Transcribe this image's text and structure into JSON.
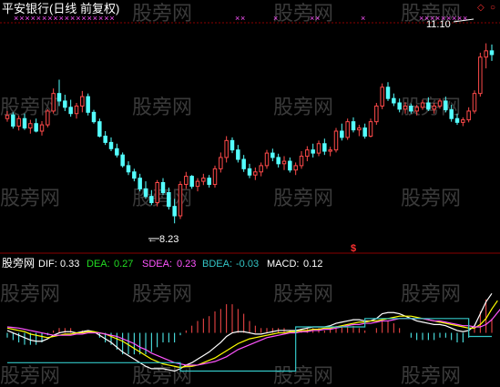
{
  "header": {
    "title": "平安银行(日线 前复权)"
  },
  "watermark": "股旁网",
  "indicator_bar": {
    "source": "股旁网",
    "dif_label": "DIF:",
    "dif_value": "0.33",
    "dea_label": "DEA:",
    "dea_value": "0.27",
    "sdea_label": "SDEA:",
    "sdea_value": "0.23",
    "bdea_label": "BDEA:",
    "bdea_value": "-0.03",
    "macd_label": "MACD:",
    "macd_value": "0.12"
  },
  "annotations": {
    "high_label": "11.10",
    "low_label": "8.23",
    "signal_marker": "$"
  },
  "colors": {
    "up": "#ff4a4a",
    "down": "#54ffff",
    "dif": "#ffffff",
    "dea": "#ffff00",
    "sdea": "#ff55ff",
    "bdea": "#33c6c6",
    "grid": "#8a0000",
    "accent_green": "#22dd22"
  },
  "chart_data": [
    {
      "type": "candlestick",
      "title": "平安银行(日线 前复权)",
      "ylim": [
        7.9,
        11.5
      ],
      "annotated_high": 11.1,
      "annotated_low": 8.23,
      "ohlc": [
        [
          9.9,
          10.02,
          9.85,
          9.95
        ],
        [
          9.96,
          10.0,
          9.74,
          9.78
        ],
        [
          9.78,
          9.95,
          9.71,
          9.9
        ],
        [
          9.9,
          9.98,
          9.72,
          9.75
        ],
        [
          9.75,
          9.88,
          9.66,
          9.82
        ],
        [
          9.82,
          9.9,
          9.68,
          9.7
        ],
        [
          9.7,
          9.86,
          9.63,
          9.8
        ],
        [
          9.8,
          10.05,
          9.76,
          10.02
        ],
        [
          10.02,
          10.38,
          9.98,
          10.3
        ],
        [
          10.3,
          10.52,
          10.1,
          10.18
        ],
        [
          10.18,
          10.28,
          10.02,
          10.08
        ],
        [
          10.08,
          10.2,
          9.93,
          9.98
        ],
        [
          9.98,
          10.15,
          9.9,
          10.1
        ],
        [
          10.1,
          10.34,
          10.0,
          10.25
        ],
        [
          10.25,
          10.3,
          9.95,
          10.0
        ],
        [
          10.0,
          10.04,
          9.82,
          9.85
        ],
        [
          9.85,
          9.9,
          9.6,
          9.62
        ],
        [
          9.62,
          9.7,
          9.48,
          9.52
        ],
        [
          9.52,
          9.6,
          9.38,
          9.42
        ],
        [
          9.42,
          9.5,
          9.28,
          9.32
        ],
        [
          9.32,
          9.36,
          9.12,
          9.15
        ],
        [
          9.15,
          9.22,
          9.0,
          9.05
        ],
        [
          9.05,
          9.1,
          8.9,
          8.95
        ],
        [
          8.95,
          9.02,
          8.74,
          8.78
        ],
        [
          8.78,
          8.9,
          8.62,
          8.66
        ],
        [
          8.66,
          8.76,
          8.52,
          8.56
        ],
        [
          8.56,
          8.92,
          8.5,
          8.88
        ],
        [
          8.88,
          8.95,
          8.68,
          8.72
        ],
        [
          8.72,
          8.8,
          8.45,
          8.5
        ],
        [
          8.5,
          8.62,
          8.23,
          8.35
        ],
        [
          8.35,
          8.9,
          8.3,
          8.85
        ],
        [
          8.85,
          9.05,
          8.78,
          8.98
        ],
        [
          8.98,
          9.0,
          8.78,
          8.82
        ],
        [
          8.82,
          8.95,
          8.74,
          8.9
        ],
        [
          8.9,
          9.02,
          8.84,
          8.95
        ],
        [
          8.95,
          9.0,
          8.8,
          8.85
        ],
        [
          8.85,
          9.15,
          8.8,
          9.1
        ],
        [
          9.1,
          9.36,
          9.04,
          9.28
        ],
        [
          9.28,
          9.62,
          9.2,
          9.55
        ],
        [
          9.55,
          9.6,
          9.35,
          9.4
        ],
        [
          9.4,
          9.48,
          9.2,
          9.25
        ],
        [
          9.25,
          9.32,
          9.05,
          9.1
        ],
        [
          9.1,
          9.18,
          8.95,
          9.0
        ],
        [
          9.0,
          9.12,
          8.92,
          9.05
        ],
        [
          9.05,
          9.2,
          8.98,
          9.15
        ],
        [
          9.15,
          9.4,
          9.1,
          9.35
        ],
        [
          9.35,
          9.42,
          9.22,
          9.28
        ],
        [
          9.28,
          9.34,
          9.12,
          9.18
        ],
        [
          9.18,
          9.3,
          9.08,
          9.22
        ],
        [
          9.22,
          9.28,
          9.04,
          9.08
        ],
        [
          9.08,
          9.2,
          9.0,
          9.15
        ],
        [
          9.15,
          9.38,
          9.1,
          9.3
        ],
        [
          9.3,
          9.46,
          9.22,
          9.4
        ],
        [
          9.4,
          9.5,
          9.28,
          9.35
        ],
        [
          9.35,
          9.55,
          9.3,
          9.5
        ],
        [
          9.5,
          9.58,
          9.32,
          9.38
        ],
        [
          9.38,
          9.45,
          9.3,
          9.4
        ],
        [
          9.4,
          9.75,
          9.36,
          9.7
        ],
        [
          9.7,
          9.82,
          9.55,
          9.6
        ],
        [
          9.6,
          9.9,
          9.56,
          9.85
        ],
        [
          9.85,
          9.92,
          9.68,
          9.72
        ],
        [
          9.72,
          9.8,
          9.62,
          9.75
        ],
        [
          9.75,
          9.82,
          9.58,
          9.62
        ],
        [
          9.62,
          9.9,
          9.6,
          9.85
        ],
        [
          9.85,
          10.15,
          9.8,
          10.1
        ],
        [
          10.1,
          10.46,
          10.05,
          10.4
        ],
        [
          10.4,
          10.48,
          10.18,
          10.22
        ],
        [
          10.22,
          10.3,
          10.1,
          10.15
        ],
        [
          10.15,
          10.22,
          10.0,
          10.05
        ],
        [
          10.05,
          10.16,
          9.98,
          10.1
        ],
        [
          10.1,
          10.14,
          9.98,
          10.02
        ],
        [
          10.02,
          10.12,
          9.95,
          10.08
        ],
        [
          10.08,
          10.2,
          10.04,
          10.15
        ],
        [
          10.15,
          10.24,
          10.02,
          10.05
        ],
        [
          10.05,
          10.15,
          9.98,
          10.1
        ],
        [
          10.1,
          10.22,
          10.06,
          10.18
        ],
        [
          10.18,
          10.25,
          10.0,
          10.04
        ],
        [
          10.04,
          10.12,
          9.85,
          9.9
        ],
        [
          9.9,
          9.98,
          9.8,
          9.84
        ],
        [
          9.84,
          9.92,
          9.78,
          9.88
        ],
        [
          9.88,
          10.08,
          9.84,
          10.02
        ],
        [
          10.02,
          10.35,
          9.98,
          10.3
        ],
        [
          10.3,
          10.95,
          10.25,
          10.88
        ],
        [
          10.88,
          11.1,
          10.7,
          10.98
        ],
        [
          10.98,
          11.08,
          10.82,
          10.92
        ]
      ]
    },
    {
      "type": "line",
      "title": "",
      "ylim": [
        -0.4,
        0.5
      ],
      "series": [
        {
          "name": "DIF",
          "values": [
            0.02,
            0.0,
            -0.02,
            -0.04,
            -0.06,
            -0.07,
            -0.07,
            -0.05,
            -0.02,
            0.0,
            0.01,
            0.01,
            0.0,
            0.01,
            0.02,
            0.01,
            -0.02,
            -0.05,
            -0.08,
            -0.12,
            -0.16,
            -0.19,
            -0.22,
            -0.25,
            -0.28,
            -0.3,
            -0.3,
            -0.3,
            -0.31,
            -0.32,
            -0.3,
            -0.27,
            -0.25,
            -0.22,
            -0.19,
            -0.16,
            -0.12,
            -0.08,
            -0.03,
            0.0,
            0.01,
            0.01,
            0.0,
            -0.01,
            -0.01,
            0.0,
            0.01,
            0.02,
            0.02,
            0.02,
            0.02,
            0.03,
            0.04,
            0.05,
            0.05,
            0.05,
            0.06,
            0.08,
            0.09,
            0.1,
            0.11,
            0.11,
            0.1,
            0.1,
            0.12,
            0.16,
            0.17,
            0.17,
            0.16,
            0.14,
            0.12,
            0.1,
            0.09,
            0.08,
            0.07,
            0.07,
            0.06,
            0.04,
            0.02,
            0.01,
            0.02,
            0.06,
            0.16,
            0.26,
            0.33
          ]
        },
        {
          "name": "DEA",
          "values": [
            0.04,
            0.03,
            0.02,
            0.01,
            -0.01,
            -0.02,
            -0.03,
            -0.04,
            -0.03,
            -0.02,
            -0.01,
            -0.01,
            0.0,
            0.0,
            0.01,
            0.01,
            0.0,
            -0.01,
            -0.03,
            -0.05,
            -0.07,
            -0.1,
            -0.13,
            -0.16,
            -0.19,
            -0.22,
            -0.24,
            -0.26,
            -0.27,
            -0.28,
            -0.29,
            -0.28,
            -0.28,
            -0.27,
            -0.25,
            -0.23,
            -0.21,
            -0.18,
            -0.15,
            -0.12,
            -0.09,
            -0.07,
            -0.05,
            -0.04,
            -0.03,
            -0.02,
            -0.01,
            0.0,
            0.0,
            0.01,
            0.01,
            0.02,
            0.02,
            0.03,
            0.03,
            0.04,
            0.04,
            0.05,
            0.06,
            0.07,
            0.08,
            0.09,
            0.09,
            0.1,
            0.1,
            0.11,
            0.12,
            0.13,
            0.14,
            0.14,
            0.14,
            0.13,
            0.12,
            0.11,
            0.1,
            0.09,
            0.08,
            0.07,
            0.06,
            0.05,
            0.04,
            0.04,
            0.07,
            0.12,
            0.2,
            0.27
          ]
        },
        {
          "name": "SDEA",
          "values": [
            0.05,
            0.045,
            0.04,
            0.03,
            0.02,
            0.01,
            0.0,
            -0.01,
            -0.02,
            -0.02,
            -0.02,
            -0.02,
            -0.01,
            -0.01,
            0.0,
            0.0,
            0.0,
            -0.01,
            -0.02,
            -0.03,
            -0.05,
            -0.07,
            -0.09,
            -0.12,
            -0.14,
            -0.17,
            -0.19,
            -0.21,
            -0.23,
            -0.25,
            -0.26,
            -0.27,
            -0.27,
            -0.27,
            -0.26,
            -0.25,
            -0.24,
            -0.22,
            -0.2,
            -0.17,
            -0.14,
            -0.12,
            -0.1,
            -0.08,
            -0.06,
            -0.04,
            -0.03,
            -0.02,
            -0.01,
            0.0,
            0.0,
            0.01,
            0.01,
            0.02,
            0.02,
            0.03,
            0.03,
            0.04,
            0.05,
            0.06,
            0.07,
            0.07,
            0.08,
            0.08,
            0.09,
            0.1,
            0.1,
            0.11,
            0.12,
            0.12,
            0.12,
            0.12,
            0.12,
            0.11,
            0.1,
            0.1,
            0.09,
            0.08,
            0.07,
            0.06,
            0.06,
            0.05,
            0.05,
            0.07,
            0.11,
            0.17,
            0.23
          ]
        },
        {
          "name": "BDEA",
          "values": [
            -0.25,
            -0.25,
            -0.25,
            -0.25,
            -0.25,
            -0.25,
            -0.25,
            -0.25,
            -0.25,
            -0.25,
            -0.25,
            -0.25,
            -0.25,
            -0.25,
            -0.25,
            -0.25,
            -0.25,
            -0.25,
            -0.25,
            -0.25,
            -0.25,
            -0.25,
            -0.25,
            -0.25,
            -0.25,
            -0.25,
            -0.25,
            -0.25,
            -0.25,
            -0.25,
            -0.32,
            -0.32,
            -0.32,
            -0.32,
            -0.32,
            -0.32,
            -0.32,
            -0.32,
            -0.32,
            -0.32,
            -0.32,
            -0.32,
            -0.32,
            -0.32,
            -0.32,
            -0.32,
            -0.32,
            -0.32,
            -0.32,
            -0.32,
            0.05,
            0.05,
            0.05,
            0.05,
            0.05,
            0.05,
            0.05,
            0.05,
            0.05,
            0.05,
            0.05,
            0.05,
            0.12,
            0.12,
            0.12,
            0.12,
            0.12,
            0.12,
            0.12,
            0.12,
            0.12,
            0.12,
            0.12,
            0.12,
            0.12,
            0.12,
            0.12,
            0.12,
            0.12,
            0.12,
            -0.03,
            -0.03,
            -0.03,
            -0.03,
            -0.03
          ]
        },
        {
          "name": "MACD",
          "values": [
            -0.04,
            -0.06,
            -0.08,
            -0.1,
            -0.1,
            -0.1,
            -0.08,
            -0.02,
            0.02,
            0.04,
            0.04,
            0.04,
            0.0,
            0.02,
            0.02,
            0.0,
            -0.04,
            -0.08,
            -0.1,
            -0.14,
            -0.18,
            -0.18,
            -0.18,
            -0.18,
            -0.18,
            -0.16,
            -0.12,
            -0.08,
            -0.08,
            -0.08,
            -0.02,
            0.02,
            0.06,
            0.1,
            0.12,
            0.14,
            0.18,
            0.2,
            0.24,
            0.24,
            0.2,
            0.16,
            0.1,
            0.06,
            0.04,
            0.04,
            0.04,
            0.04,
            0.04,
            0.02,
            0.02,
            0.02,
            0.04,
            0.04,
            0.04,
            0.02,
            0.04,
            0.06,
            0.06,
            0.06,
            0.06,
            0.04,
            0.02,
            0.0,
            0.04,
            0.1,
            0.1,
            0.08,
            0.04,
            0.0,
            -0.04,
            -0.06,
            -0.06,
            -0.06,
            -0.06,
            -0.04,
            -0.04,
            -0.06,
            -0.08,
            -0.08,
            -0.04,
            0.04,
            0.18,
            0.28,
            0.12
          ]
        }
      ]
    }
  ]
}
